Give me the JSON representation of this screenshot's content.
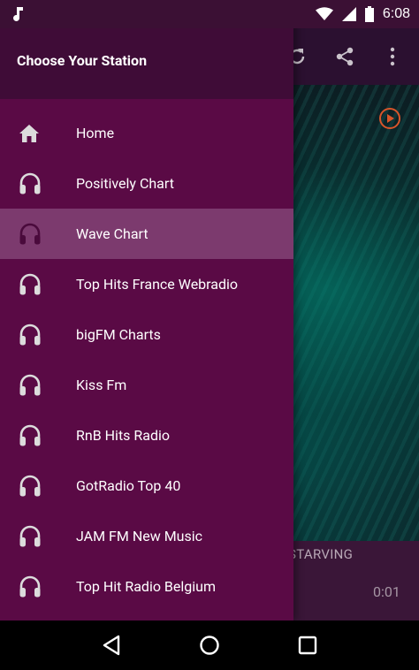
{
  "status_bar": {
    "time": "6:08",
    "icons": [
      "music-note-icon",
      "wifi-icon",
      "signal-icon",
      "battery-icon"
    ]
  },
  "drawer": {
    "title": "Choose Your Station",
    "active_index": 2,
    "items": [
      {
        "label": "Home",
        "icon": "home-icon"
      },
      {
        "label": "Positively Chart",
        "icon": "headphones-icon"
      },
      {
        "label": "Wave Chart",
        "icon": "headphones-icon"
      },
      {
        "label": "Top Hits France Webradio",
        "icon": "headphones-icon"
      },
      {
        "label": "bigFM Charts",
        "icon": "headphones-icon"
      },
      {
        "label": "Kiss Fm",
        "icon": "headphones-icon"
      },
      {
        "label": "RnB Hits Radio",
        "icon": "headphones-icon"
      },
      {
        "label": "GotRadio Top 40",
        "icon": "headphones-icon"
      },
      {
        "label": "JAM FM New Music",
        "icon": "headphones-icon"
      },
      {
        "label": "Top Hit Radio Belgium",
        "icon": "headphones-icon"
      }
    ]
  },
  "background_app": {
    "toolbar_icons": [
      "refresh-icon",
      "share-icon",
      "more-vert-icon"
    ],
    "now_playing_title": "STARVING",
    "elapsed_time": "0:01"
  },
  "nav_bar": {
    "icons": [
      "back-icon",
      "home-circle-icon",
      "recents-icon"
    ]
  },
  "colors": {
    "drawer_bg": "#5a0a45",
    "drawer_header_bg": "#3f0c37",
    "active_item_bg": "#7c3a6e",
    "status_bar_bg": "#3b1034",
    "accent_orange": "#d8552a"
  }
}
